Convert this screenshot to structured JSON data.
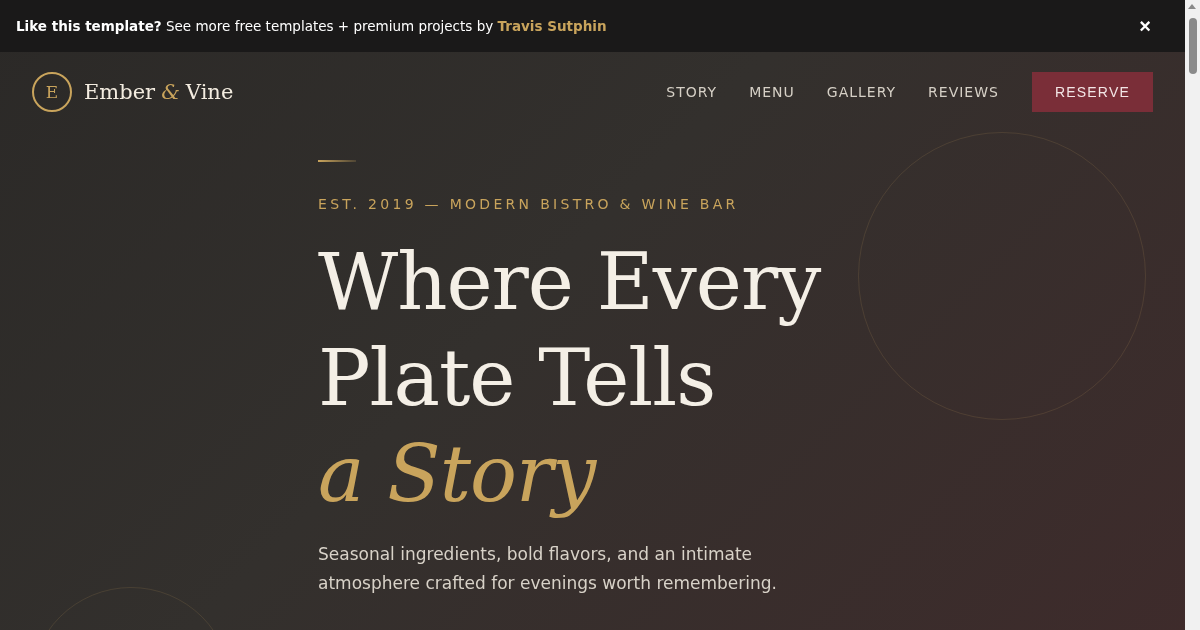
{
  "banner": {
    "text": "**Like this template?** See more free templates + premium projects by",
    "link": "Travis Sutphin",
    "close": "×"
  },
  "nav": {
    "logo": {
      "monogram": "E",
      "name_start": "Ember",
      "ampersand": "&",
      "name_end": "Vine"
    },
    "links": [
      "STORY",
      "MENU",
      "GALLERY",
      "REVIEWS"
    ],
    "cta": "RESERVE"
  },
  "hero": {
    "eyebrow": "EST. 2019 — MODERN BISTRO & WINE BAR",
    "headline_lines": [
      "Where Every",
      "Plate Tells"
    ],
    "headline_accent": "a Story",
    "description": "Seasonal ingredients, bold flavors, and an intimate atmosphere crafted for evenings worth remembering."
  }
}
